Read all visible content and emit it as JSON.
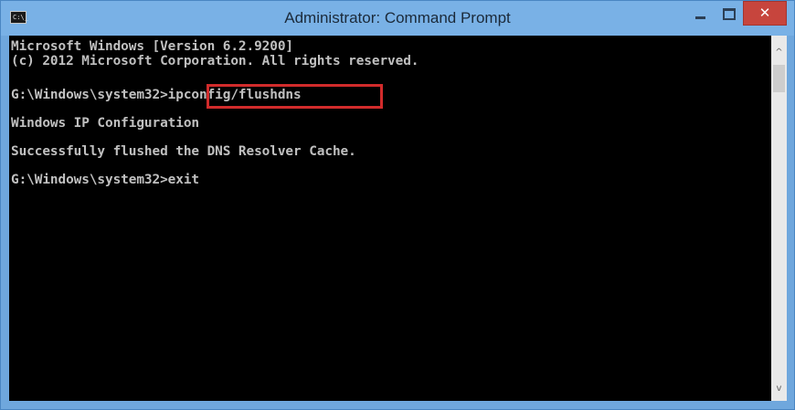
{
  "window": {
    "title": "Administrator: Command Prompt",
    "icon_label": "C:\\_",
    "close_glyph": "✕"
  },
  "console": {
    "lines": [
      "Microsoft Windows [Version 6.2.9200]",
      "(c) 2012 Microsoft Corporation. All rights reserved.",
      "G:\\Windows\\system32>ipconfig/flushdns",
      "Windows IP Configuration",
      "Successfully flushed the DNS Resolver Cache.",
      "G:\\Windows\\system32>exit"
    ],
    "highlighted_command": "ipconfig/flushdns"
  },
  "scrollbar": {
    "up_glyph": "^",
    "down_glyph": "v"
  },
  "colors": {
    "titlebar": "#79b1e6",
    "close_button": "#c7453d",
    "console_bg": "#000000",
    "console_text": "#c0c0c0",
    "highlight_box": "#d12b2b"
  }
}
